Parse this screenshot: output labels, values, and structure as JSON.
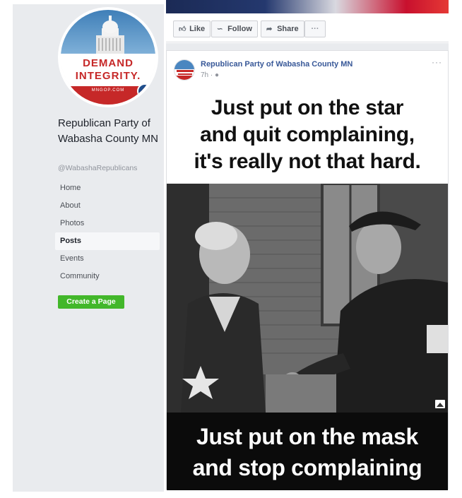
{
  "sidebar": {
    "avatar": {
      "line1": "DEMAND",
      "line2": "INTEGRITY.",
      "strip_text": "MNGOP.COM"
    },
    "page_name": "Republican Party of Wabasha County MN",
    "handle": "@WabashaRepublicans",
    "nav": [
      {
        "label": "Home",
        "active": false
      },
      {
        "label": "About",
        "active": false
      },
      {
        "label": "Photos",
        "active": false
      },
      {
        "label": "Posts",
        "active": true
      },
      {
        "label": "Events",
        "active": false
      },
      {
        "label": "Community",
        "active": false
      }
    ],
    "create_page_label": "Create a Page",
    "create_page_color": "#42b72a"
  },
  "actions": {
    "like": "Like",
    "follow": "Follow",
    "share": "Share",
    "more": "···"
  },
  "post": {
    "author": "Republican Party of Wabasha County MN",
    "time": "7h · ",
    "audience_icon": "globe-icon",
    "menu": "···",
    "meme_top_lines": [
      "Just put on the star",
      "and quit complaining,",
      "it's really not that hard."
    ],
    "meme_bottom_lines": [
      "Just put on the mask",
      "and stop complaining"
    ]
  },
  "colors": {
    "link": "#385898",
    "sidebar_bg": "#e9ebee",
    "avatar_red": "#c62828"
  }
}
